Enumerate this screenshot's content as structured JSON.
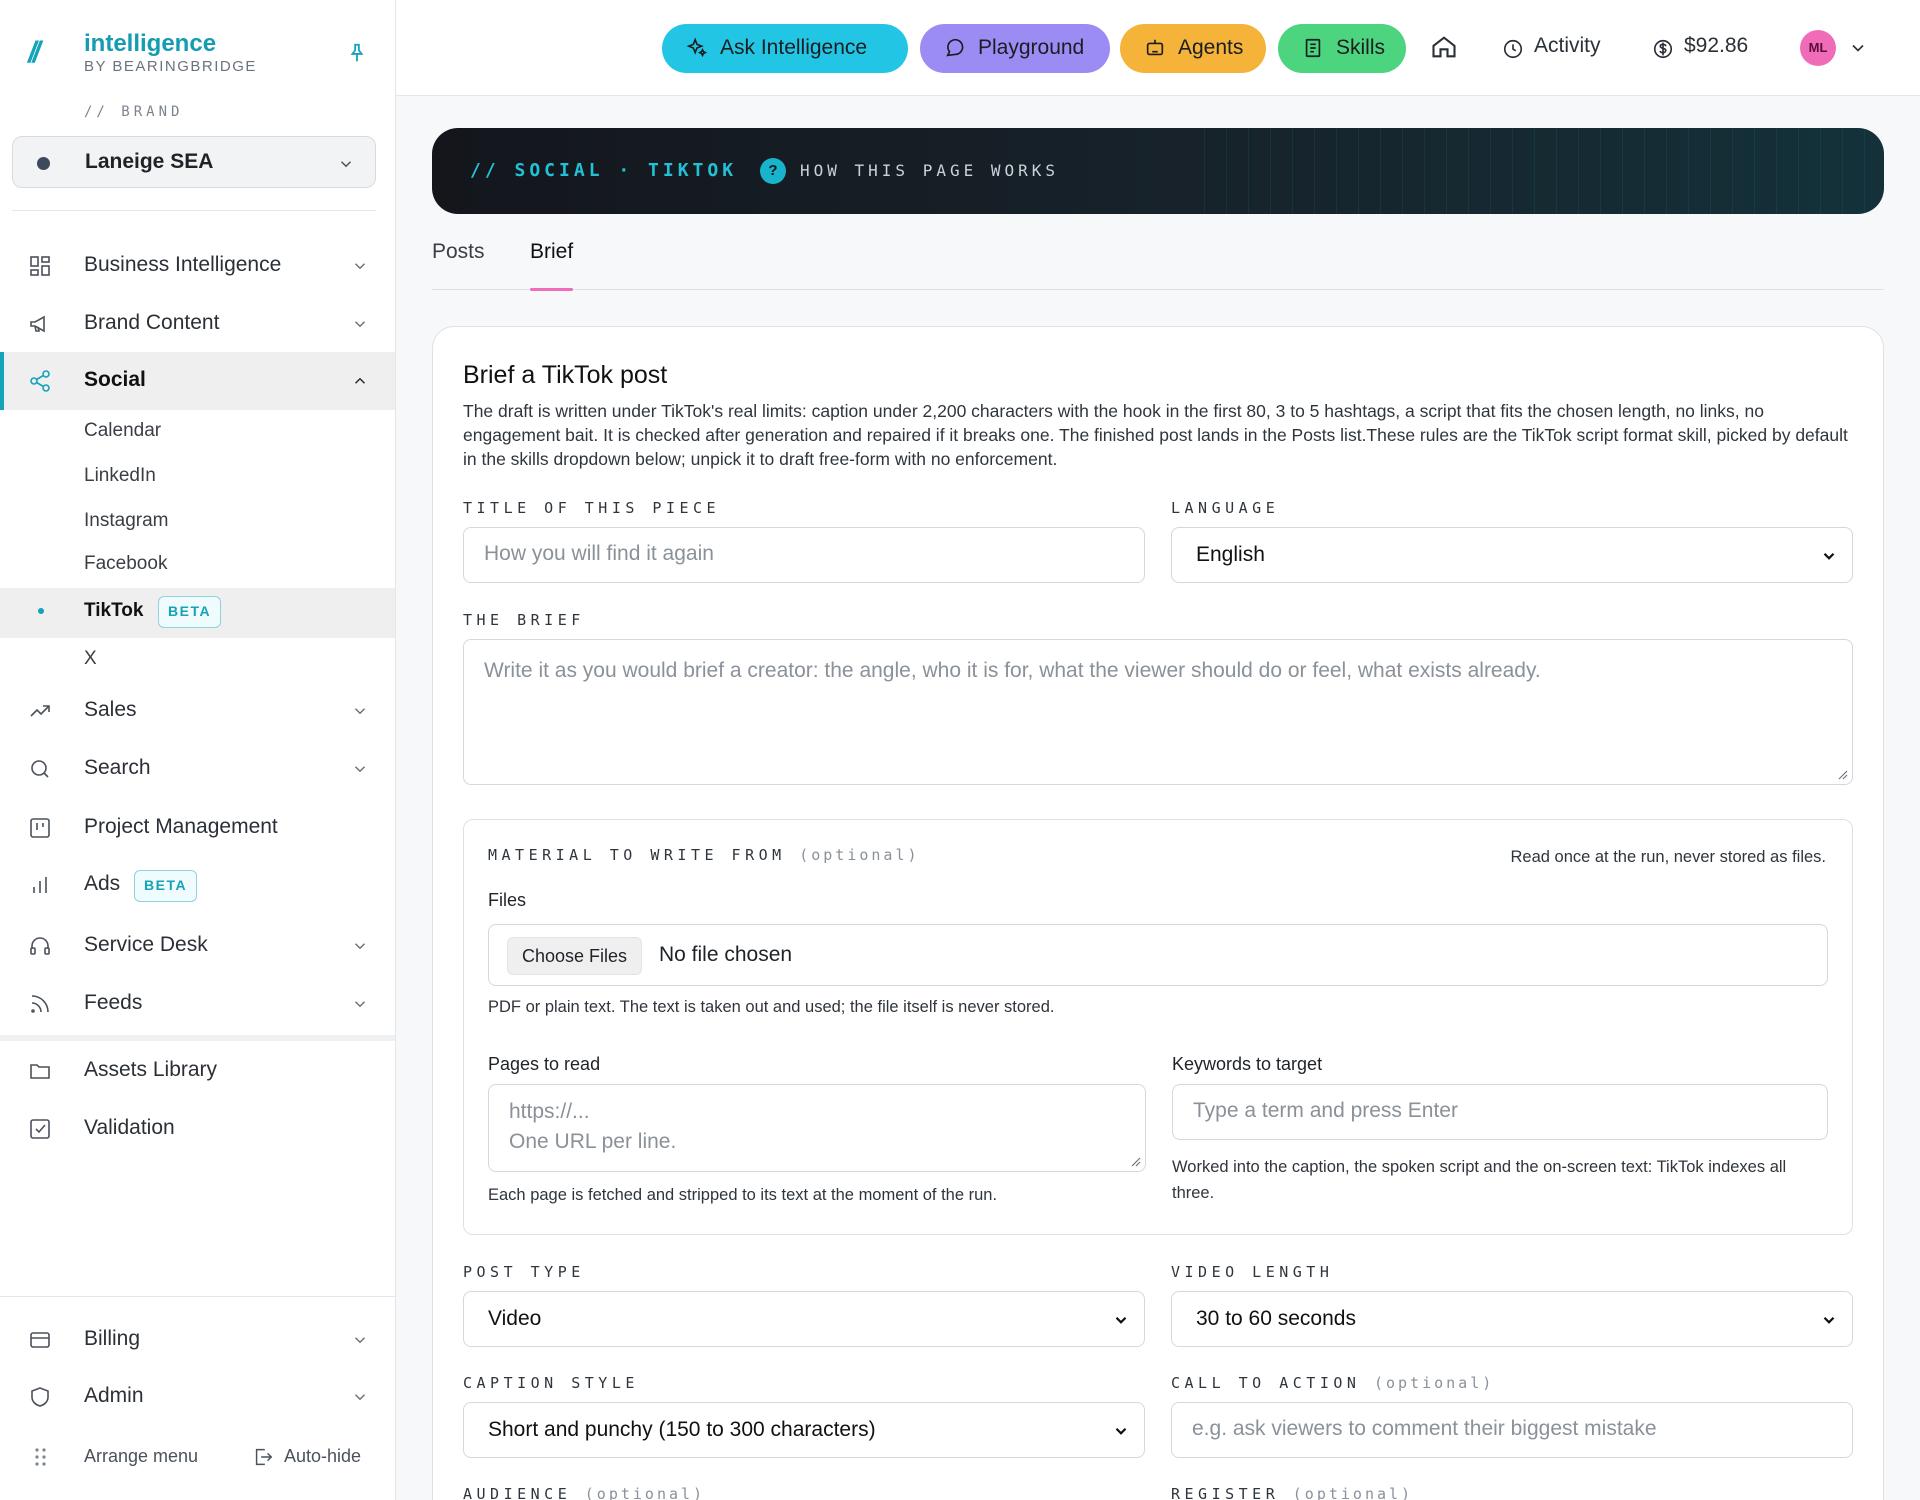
{
  "app": {
    "name": "intelligence",
    "sub": "BY BEARINGBRIDGE",
    "brand_label": "// BRAND",
    "brand_value": "Laneige SEA"
  },
  "sidebar": {
    "items": [
      {
        "label": "Business Intelligence",
        "icon": "grid-icon"
      },
      {
        "label": "Brand Content",
        "icon": "megaphone-icon"
      },
      {
        "label": "Social",
        "icon": "share-icon"
      },
      {
        "label": "Sales",
        "icon": "trend-icon"
      },
      {
        "label": "Search",
        "icon": "search-icon"
      },
      {
        "label": "Project Management",
        "icon": "kanban-icon"
      },
      {
        "label": "Ads",
        "icon": "bar-chart-icon",
        "badge": "BETA"
      },
      {
        "label": "Service Desk",
        "icon": "headset-icon"
      },
      {
        "label": "Feeds",
        "icon": "rss-icon"
      },
      {
        "label": "Assets Library",
        "icon": "folder-icon"
      },
      {
        "label": "Validation",
        "icon": "check-square-icon"
      }
    ],
    "social_sub": [
      {
        "label": "Calendar"
      },
      {
        "label": "LinkedIn"
      },
      {
        "label": "Instagram"
      },
      {
        "label": "Facebook"
      },
      {
        "label": "TikTok",
        "badge": "BETA"
      },
      {
        "label": "X"
      }
    ],
    "footer": [
      {
        "label": "Billing",
        "icon": "card-icon"
      },
      {
        "label": "Admin",
        "icon": "shield-icon"
      }
    ],
    "arrange_label": "Arrange menu",
    "autohide_label": "Auto-hide"
  },
  "topbar": {
    "ask": "Ask Intelligence",
    "playground": "Playground",
    "agents": "Agents",
    "skills": "Skills",
    "activity": "Activity",
    "balance": "$92.86",
    "avatar": "ML",
    "colors": {
      "ask": "#22c6e4",
      "playground": "#9b8cf4",
      "agents": "#f5b33a",
      "skills": "#4cd47e"
    }
  },
  "banner": {
    "crumb": "// SOCIAL · TIKTOK",
    "help_icon": "?",
    "help_label": "HOW THIS PAGE WORKS"
  },
  "tabs": [
    {
      "label": "Posts"
    },
    {
      "label": "Brief"
    }
  ],
  "form": {
    "title": "Brief a TikTok post",
    "description": "The draft is written under TikTok's real limits: caption under 2,200 characters with the hook in the first 80, 3 to 5 hashtags, a script that fits the chosen length, no links, no engagement bait. It is checked after generation and repaired if it breaks one. The finished post lands in the Posts list.These rules are the TikTok script format skill, picked by default in the skills dropdown below; unpick it to draft free-form with no enforcement.",
    "title_label": "TITLE OF THIS PIECE",
    "title_placeholder": "How you will find it again",
    "language_label": "LANGUAGE",
    "language_value": "English",
    "brief_label": "THE BRIEF",
    "brief_placeholder": "Write it as you would brief a creator: the angle, who it is for, what the viewer should do or feel, what exists already.",
    "material": {
      "label": "MATERIAL TO WRITE FROM",
      "optional": "(optional)",
      "note": "Read once at the run, never stored as files.",
      "files_label": "Files",
      "choose_files": "Choose Files",
      "file_status": "No file chosen",
      "files_help": "PDF or plain text. The text is taken out and used; the file itself is never stored.",
      "pages_label": "Pages to read",
      "pages_placeholder_1": "https://...",
      "pages_placeholder_2": "One URL per line.",
      "pages_help": "Each page is fetched and stripped to its text at the moment of the run.",
      "keywords_label": "Keywords to target",
      "keywords_placeholder": "Type a term and press Enter",
      "keywords_help": "Worked into the caption, the spoken script and the on-screen text: TikTok indexes all three."
    },
    "post_type_label": "POST TYPE",
    "post_type_value": "Video",
    "video_length_label": "VIDEO LENGTH",
    "video_length_value": "30 to 60 seconds",
    "caption_style_label": "CAPTION STYLE",
    "caption_style_value": "Short and punchy (150 to 300 characters)",
    "cta_label": "CALL TO ACTION",
    "cta_optional": "(optional)",
    "cta_placeholder": "e.g. ask viewers to comment their biggest mistake",
    "audience_label": "AUDIENCE",
    "audience_optional": "(optional)",
    "register_label": "REGISTER",
    "register_optional": "(optional)"
  }
}
